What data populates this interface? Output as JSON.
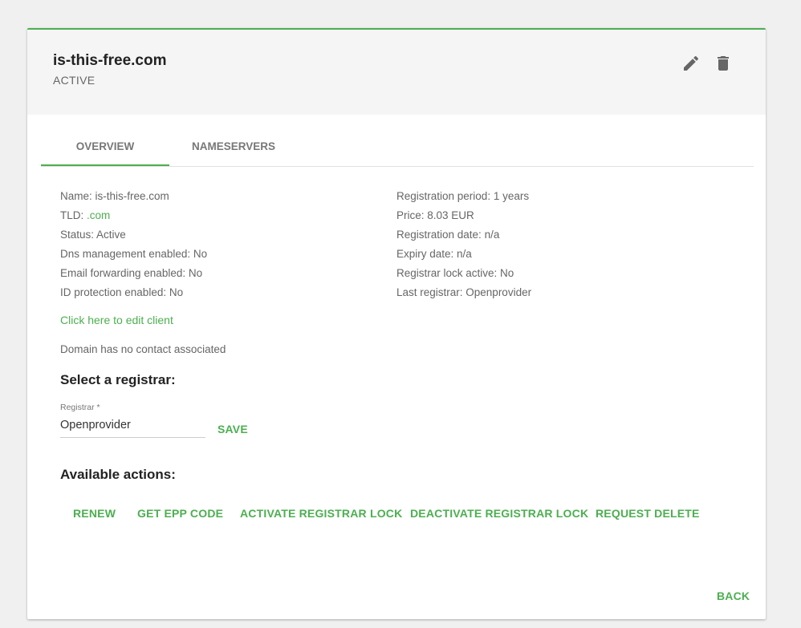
{
  "header": {
    "title": "is-this-free.com",
    "status": "ACTIVE",
    "edit_icon": "pencil-icon",
    "delete_icon": "trash-icon"
  },
  "tabs": [
    {
      "label": "OVERVIEW",
      "active": true
    },
    {
      "label": "NAMESERVERS",
      "active": false
    }
  ],
  "details_left": {
    "name": {
      "label": "Name: ",
      "value": "is-this-free.com"
    },
    "tld": {
      "label": "TLD: ",
      "value": ".com"
    },
    "status": {
      "label": "Status: ",
      "value": "Active"
    },
    "dns": {
      "label": "Dns management enabled: ",
      "value": "No"
    },
    "email": {
      "label": "Email forwarding enabled: ",
      "value": "No"
    },
    "idprot": {
      "label": "ID protection enabled: ",
      "value": "No"
    }
  },
  "details_right": {
    "period": {
      "label": "Registration period: ",
      "value": "1 years"
    },
    "price": {
      "label": "Price: ",
      "value": "8.03 EUR"
    },
    "regdate": {
      "label": "Registration date: ",
      "value": "n/a"
    },
    "expiry": {
      "label": "Expiry date: ",
      "value": "n/a"
    },
    "lock": {
      "label": "Registrar lock active: ",
      "value": "No"
    },
    "last": {
      "label": "Last registrar: ",
      "value": "Openprovider"
    }
  },
  "edit_client_link": "Click here to edit client",
  "no_contact_text": "Domain has no contact associated",
  "registrar": {
    "section_title": "Select a registrar:",
    "field_label": "Registrar *",
    "field_value": "Openprovider",
    "save_label": "SAVE"
  },
  "actions": {
    "section_title": "Available actions:",
    "renew": "RENEW",
    "epp": "GET EPP CODE",
    "activate_lock": "ACTIVATE REGISTRAR LOCK",
    "deactivate_lock": "DEACTIVATE REGISTRAR LOCK",
    "request_delete": "REQUEST DELETE"
  },
  "back_label": "BACK",
  "colors": {
    "accent": "#4caf50"
  }
}
